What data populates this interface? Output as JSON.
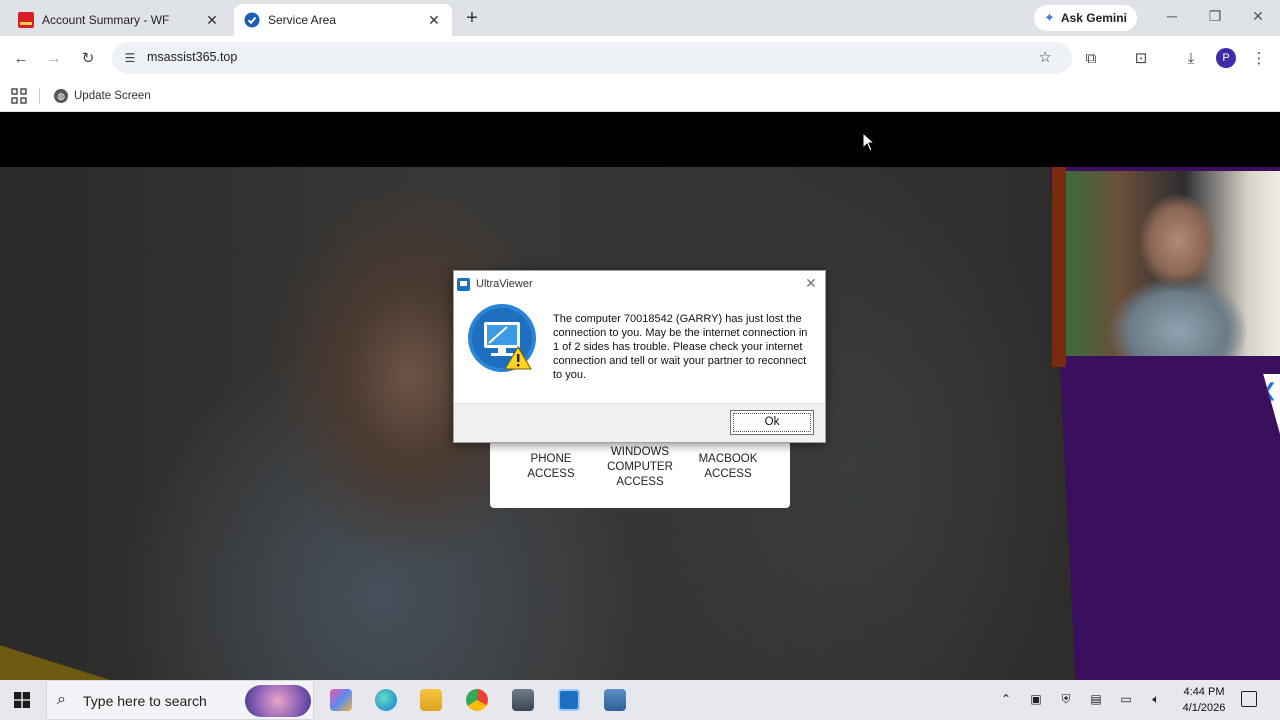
{
  "browser": {
    "tabs": [
      {
        "title": "Account Summary - WF",
        "active": false,
        "favicon": "wf-favicon"
      },
      {
        "title": "Service Area",
        "active": true,
        "favicon": "service-favicon"
      }
    ],
    "new_tab_label": "+",
    "gemini_label": "Ask Gemini",
    "url": "msassist365.top",
    "profile_initial": "P",
    "bookmarks": [
      {
        "label": "Update Screen",
        "icon": "globe-icon"
      }
    ]
  },
  "page": {
    "access_options": [
      {
        "label": "PHONE\nACCESS"
      },
      {
        "label": "WINDOWS\nCOMPUTER\nACCESS"
      },
      {
        "label": "MACBOOK\nACCESS"
      }
    ],
    "colors": {
      "purple_panel": "#3a0f5e",
      "accent_blue": "#1d6fd1"
    }
  },
  "dialog": {
    "title": "UltraViewer",
    "message": "The computer 70018542 (GARRY) has just lost the connection to you. May be the internet connection in 1 of 2 sides has trouble. Please check your internet connection and tell or wait your partner to reconnect to you.",
    "ok_label": "Ok",
    "icon": "monitor-warning-icon"
  },
  "taskbar": {
    "search_placeholder": "Type here to search",
    "time": "4:44 PM",
    "date": "4/1/2026"
  }
}
